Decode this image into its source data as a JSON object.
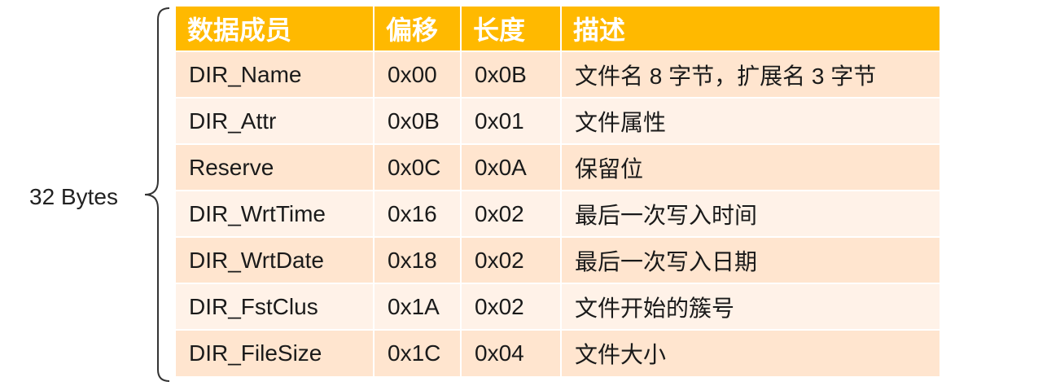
{
  "brace_label": "32 Bytes",
  "table": {
    "headers": [
      "数据成员",
      "偏移",
      "长度",
      "描述"
    ],
    "rows": [
      [
        "DIR_Name",
        "0x00",
        "0x0B",
        "文件名 8 字节，扩展名 3 字节"
      ],
      [
        "DIR_Attr",
        "0x0B",
        "0x01",
        "文件属性"
      ],
      [
        "Reserve",
        "0x0C",
        "0x0A",
        "保留位"
      ],
      [
        "DIR_WrtTime",
        "0x16",
        "0x02",
        "最后一次写入时间"
      ],
      [
        "DIR_WrtDate",
        "0x18",
        "0x02",
        "最后一次写入日期"
      ],
      [
        "DIR_FstClus",
        "0x1A",
        "0x02",
        "文件开始的簇号"
      ],
      [
        "DIR_FileSize",
        "0x1C",
        "0x04",
        "文件大小"
      ]
    ]
  },
  "colors": {
    "header_bg": "#ffb900",
    "row_odd_bg": "#ffe5cf",
    "row_even_bg": "#fff2e8"
  }
}
